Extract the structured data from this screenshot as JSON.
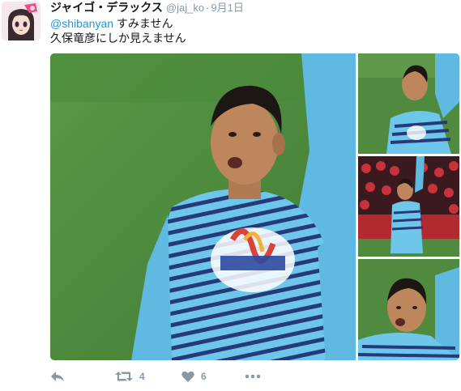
{
  "tweet": {
    "display_name": "ジャイゴ・デラックス",
    "handle": "@jaj_ko",
    "separator": "·",
    "timestamp": "9月1日",
    "mention": "@shibanyan",
    "text_line1_rest": " すみません",
    "text_line2": "久保竜彦にしか見えません"
  },
  "actions": {
    "reply_icon": "reply-icon",
    "retweet_icon": "retweet-icon",
    "retweet_count": "4",
    "like_icon": "heart-icon",
    "like_count": "6",
    "more_icon": "more-dots-icon"
  },
  "colors": {
    "link": "#1b95e0",
    "muted": "#8899a6",
    "text": "#14171a",
    "pitch_green": "#4f8a3e",
    "jersey_blue": "#5fb9e0"
  }
}
